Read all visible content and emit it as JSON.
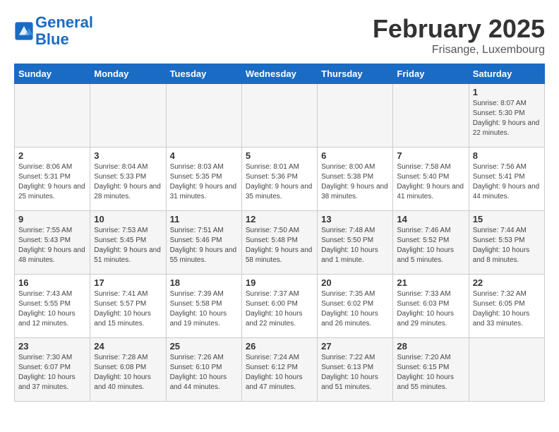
{
  "header": {
    "logo_general": "General",
    "logo_blue": "Blue",
    "month_title": "February 2025",
    "subtitle": "Frisange, Luxembourg"
  },
  "days_of_week": [
    "Sunday",
    "Monday",
    "Tuesday",
    "Wednesday",
    "Thursday",
    "Friday",
    "Saturday"
  ],
  "weeks": [
    [
      {
        "day": "",
        "info": ""
      },
      {
        "day": "",
        "info": ""
      },
      {
        "day": "",
        "info": ""
      },
      {
        "day": "",
        "info": ""
      },
      {
        "day": "",
        "info": ""
      },
      {
        "day": "",
        "info": ""
      },
      {
        "day": "1",
        "info": "Sunrise: 8:07 AM\nSunset: 5:30 PM\nDaylight: 9 hours and 22 minutes."
      }
    ],
    [
      {
        "day": "2",
        "info": "Sunrise: 8:06 AM\nSunset: 5:31 PM\nDaylight: 9 hours and 25 minutes."
      },
      {
        "day": "3",
        "info": "Sunrise: 8:04 AM\nSunset: 5:33 PM\nDaylight: 9 hours and 28 minutes."
      },
      {
        "day": "4",
        "info": "Sunrise: 8:03 AM\nSunset: 5:35 PM\nDaylight: 9 hours and 31 minutes."
      },
      {
        "day": "5",
        "info": "Sunrise: 8:01 AM\nSunset: 5:36 PM\nDaylight: 9 hours and 35 minutes."
      },
      {
        "day": "6",
        "info": "Sunrise: 8:00 AM\nSunset: 5:38 PM\nDaylight: 9 hours and 38 minutes."
      },
      {
        "day": "7",
        "info": "Sunrise: 7:58 AM\nSunset: 5:40 PM\nDaylight: 9 hours and 41 minutes."
      },
      {
        "day": "8",
        "info": "Sunrise: 7:56 AM\nSunset: 5:41 PM\nDaylight: 9 hours and 44 minutes."
      }
    ],
    [
      {
        "day": "9",
        "info": "Sunrise: 7:55 AM\nSunset: 5:43 PM\nDaylight: 9 hours and 48 minutes."
      },
      {
        "day": "10",
        "info": "Sunrise: 7:53 AM\nSunset: 5:45 PM\nDaylight: 9 hours and 51 minutes."
      },
      {
        "day": "11",
        "info": "Sunrise: 7:51 AM\nSunset: 5:46 PM\nDaylight: 9 hours and 55 minutes."
      },
      {
        "day": "12",
        "info": "Sunrise: 7:50 AM\nSunset: 5:48 PM\nDaylight: 9 hours and 58 minutes."
      },
      {
        "day": "13",
        "info": "Sunrise: 7:48 AM\nSunset: 5:50 PM\nDaylight: 10 hours and 1 minute."
      },
      {
        "day": "14",
        "info": "Sunrise: 7:46 AM\nSunset: 5:52 PM\nDaylight: 10 hours and 5 minutes."
      },
      {
        "day": "15",
        "info": "Sunrise: 7:44 AM\nSunset: 5:53 PM\nDaylight: 10 hours and 8 minutes."
      }
    ],
    [
      {
        "day": "16",
        "info": "Sunrise: 7:43 AM\nSunset: 5:55 PM\nDaylight: 10 hours and 12 minutes."
      },
      {
        "day": "17",
        "info": "Sunrise: 7:41 AM\nSunset: 5:57 PM\nDaylight: 10 hours and 15 minutes."
      },
      {
        "day": "18",
        "info": "Sunrise: 7:39 AM\nSunset: 5:58 PM\nDaylight: 10 hours and 19 minutes."
      },
      {
        "day": "19",
        "info": "Sunrise: 7:37 AM\nSunset: 6:00 PM\nDaylight: 10 hours and 22 minutes."
      },
      {
        "day": "20",
        "info": "Sunrise: 7:35 AM\nSunset: 6:02 PM\nDaylight: 10 hours and 26 minutes."
      },
      {
        "day": "21",
        "info": "Sunrise: 7:33 AM\nSunset: 6:03 PM\nDaylight: 10 hours and 29 minutes."
      },
      {
        "day": "22",
        "info": "Sunrise: 7:32 AM\nSunset: 6:05 PM\nDaylight: 10 hours and 33 minutes."
      }
    ],
    [
      {
        "day": "23",
        "info": "Sunrise: 7:30 AM\nSunset: 6:07 PM\nDaylight: 10 hours and 37 minutes."
      },
      {
        "day": "24",
        "info": "Sunrise: 7:28 AM\nSunset: 6:08 PM\nDaylight: 10 hours and 40 minutes."
      },
      {
        "day": "25",
        "info": "Sunrise: 7:26 AM\nSunset: 6:10 PM\nDaylight: 10 hours and 44 minutes."
      },
      {
        "day": "26",
        "info": "Sunrise: 7:24 AM\nSunset: 6:12 PM\nDaylight: 10 hours and 47 minutes."
      },
      {
        "day": "27",
        "info": "Sunrise: 7:22 AM\nSunset: 6:13 PM\nDaylight: 10 hours and 51 minutes."
      },
      {
        "day": "28",
        "info": "Sunrise: 7:20 AM\nSunset: 6:15 PM\nDaylight: 10 hours and 55 minutes."
      },
      {
        "day": "",
        "info": ""
      }
    ]
  ]
}
